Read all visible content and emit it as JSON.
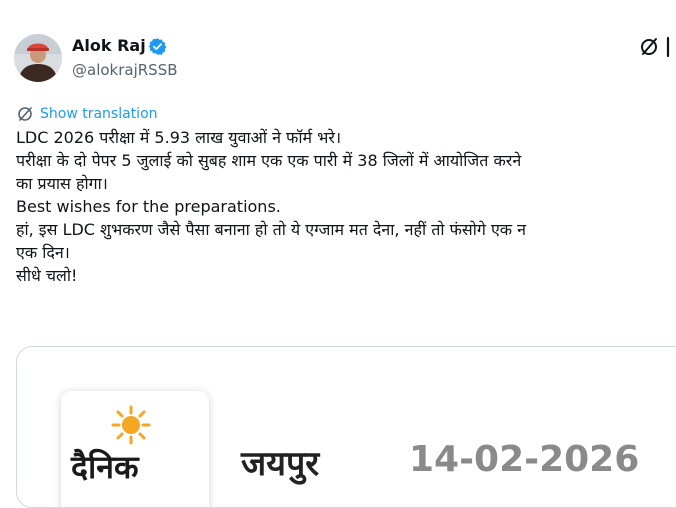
{
  "author": {
    "name": "Alok Raj",
    "handle": "@alokrajRSSB",
    "avatar_icon": "profile-photo",
    "verified_icon": "verified-badge-icon"
  },
  "actions": {
    "grok_icon": "grok-icon",
    "more_icon": "more-icon"
  },
  "translation": {
    "label": "Show translation",
    "icon": "translate-icon"
  },
  "tweet": {
    "lines": [
      "LDC 2026 परीक्षा में 5.93 लाख युवाओं ने फॉर्म भरे।",
      "परीक्षा के दो पेपर 5 जुलाई को सुबह शाम एक एक पारी में  38 जिलों में आयोजित करने",
      "का प्रयास होगा।",
      "Best wishes for the preparations.",
      "हां, इस LDC शुभकरण जैसे पैसा बनाना हो तो ये एग्जाम मत देना, नहीं तो फंसोगे एक न",
      "एक दिन।",
      "सीधे चलो!"
    ]
  },
  "media": {
    "logo_text": "दैनिक",
    "edition": "जयपुर",
    "date": "14-02-2026"
  },
  "colors": {
    "accent": "#1d9bf0",
    "text": "#0f1419",
    "secondary": "#536471",
    "border": "#cfd9de",
    "sun": "#f5a623"
  }
}
